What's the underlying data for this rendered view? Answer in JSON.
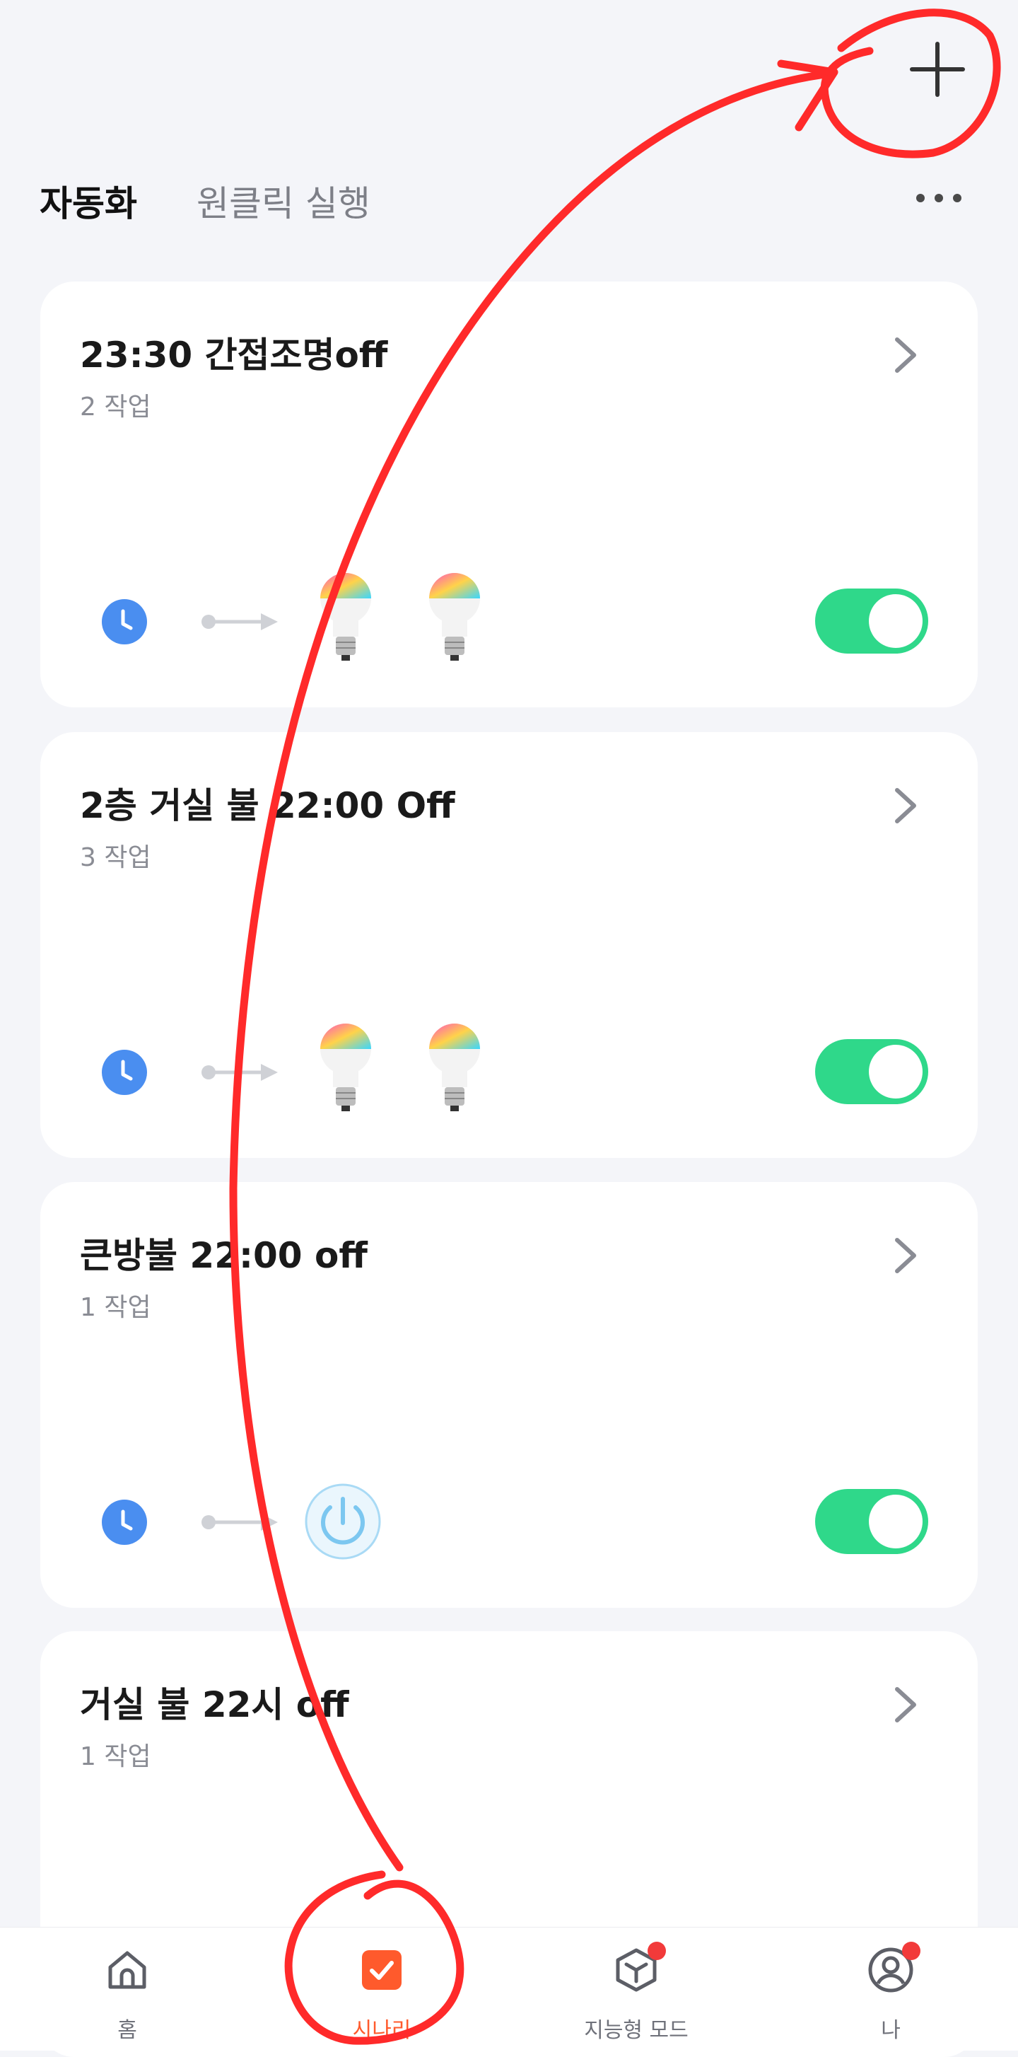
{
  "header": {
    "add_icon": "plus-icon",
    "more_icon": "more-horizontal-icon"
  },
  "tabs": [
    {
      "label": "자동화",
      "active": true
    },
    {
      "label": "원클릭 실행",
      "active": false
    }
  ],
  "cards": [
    {
      "title": "23:30 간접조명off",
      "subtitle": "2 작업",
      "trigger_icon": "clock-icon",
      "actions": [
        "bulb-icon",
        "bulb-icon"
      ],
      "enabled": true
    },
    {
      "title": "2층 거실 불 22:00 Off",
      "subtitle": "3 작업",
      "trigger_icon": "clock-icon",
      "actions": [
        "bulb-icon",
        "bulb-icon"
      ],
      "enabled": true
    },
    {
      "title": "큰방불 22:00 off",
      "subtitle": "1 작업",
      "trigger_icon": "clock-icon",
      "actions": [
        "power-icon"
      ],
      "enabled": true
    },
    {
      "title": "거실 불 22시 off",
      "subtitle": "1 작업"
    }
  ],
  "bottom_nav": [
    {
      "label": "홈",
      "icon": "home-icon",
      "active": false,
      "badge": false
    },
    {
      "label": "시나리",
      "icon": "scenario-check-icon",
      "active": true,
      "badge": false
    },
    {
      "label": "지능형 모드",
      "icon": "cube-icon",
      "active": false,
      "badge": true
    },
    {
      "label": "나",
      "icon": "profile-icon",
      "active": false,
      "badge": true
    }
  ],
  "colors": {
    "background": "#f4f5f9",
    "toggle_on": "#2fd88a",
    "accent": "#ff5a2c",
    "clock": "#4a8ef0",
    "badge": "#f23a3a",
    "annotation": "#ff2a2a"
  }
}
